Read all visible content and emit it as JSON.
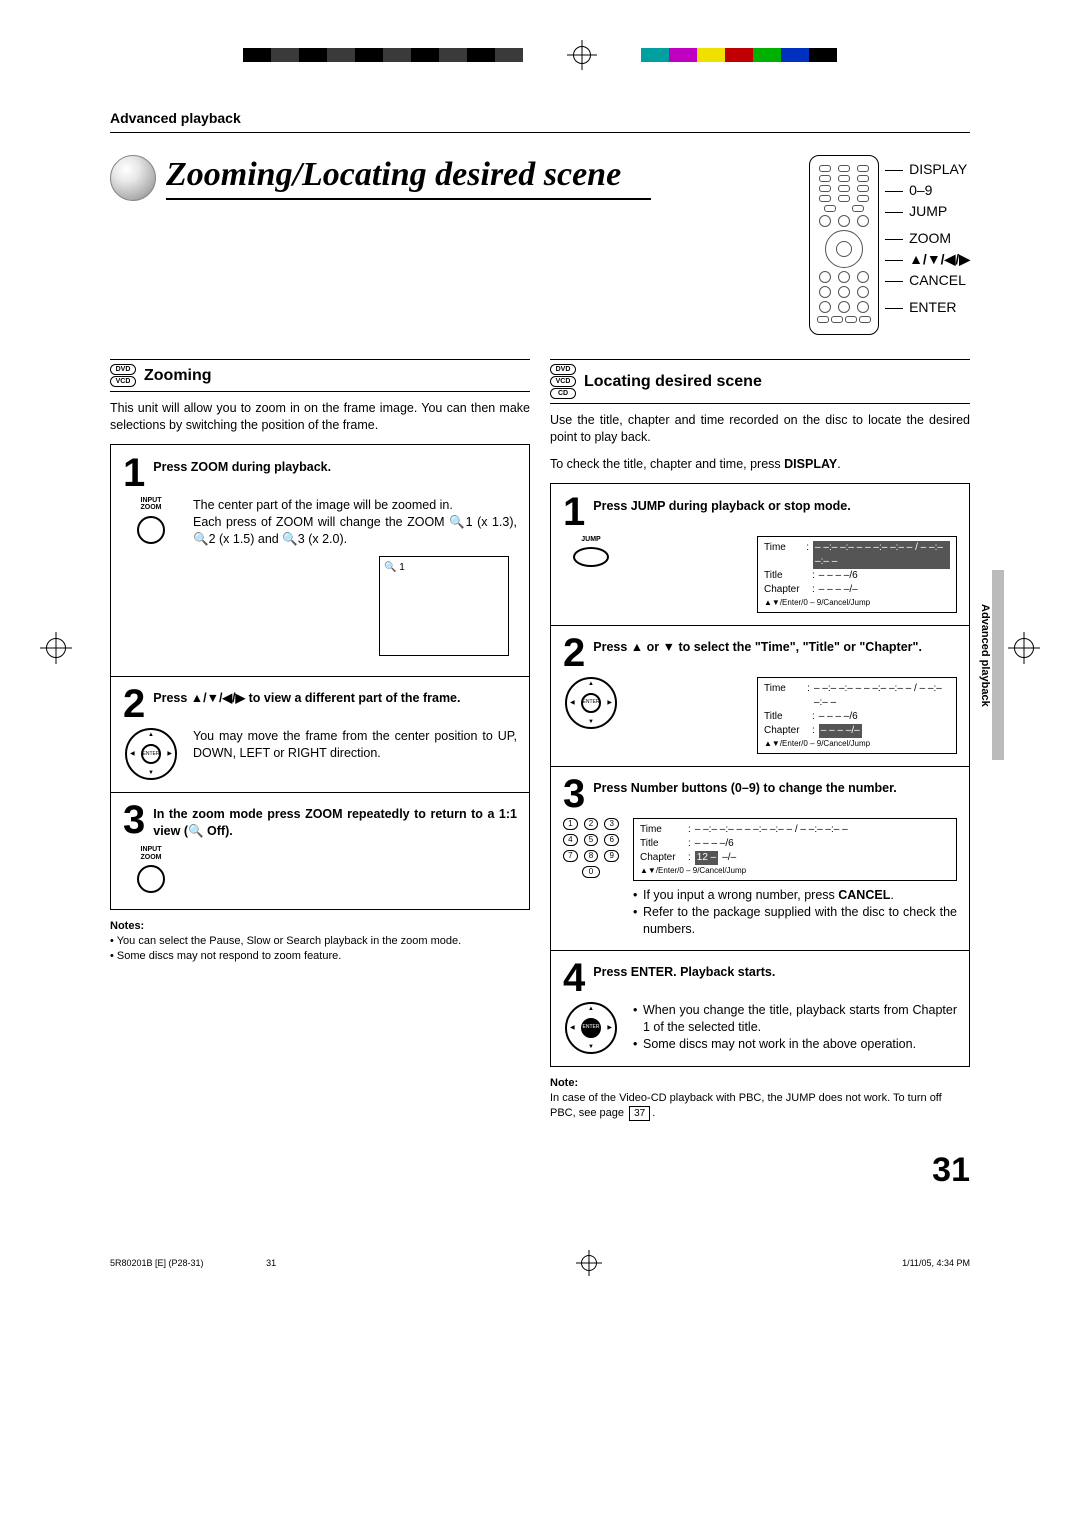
{
  "header": {
    "section": "Advanced playback"
  },
  "hero": {
    "title": "Zooming/Locating desired scene"
  },
  "remote_labels": {
    "display": "DISPLAY",
    "digits": "0–9",
    "jump": "JUMP",
    "zoom": "ZOOM",
    "arrows": "▲/▼/◀/▶",
    "cancel": "CANCEL",
    "enter": "ENTER"
  },
  "zooming": {
    "title": "Zooming",
    "intro": "This unit will allow you to zoom in on the frame image. You can then make selections by switching the position of the frame.",
    "step1": {
      "title": "Press ZOOM during playback.",
      "icon_label": "INPUT\nZOOM",
      "body1": "The center part of the image will be zoomed in.",
      "body2": "Each press of ZOOM will change the ZOOM 🔍1 (x 1.3), 🔍2 (x 1.5) and 🔍3 (x 2.0).",
      "osd": "🔍 1"
    },
    "step2": {
      "title": "Press ▲/▼/◀/▶ to view a different part of the frame.",
      "body": "You may move the frame from the center position to UP, DOWN, LEFT or RIGHT direction."
    },
    "step3": {
      "title": "In the zoom mode press ZOOM repeatedly to return to a 1:1 view (🔍 Off).",
      "icon_label": "INPUT\nZOOM"
    },
    "notes_h": "Notes:",
    "note1": "You can select the Pause, Slow or Search playback in the zoom mode.",
    "note2": "Some discs may not respond to zoom feature."
  },
  "locating": {
    "title": "Locating desired scene",
    "intro1": "Use the title, chapter and time recorded on the disc to locate the desired point to play back.",
    "intro2_a": "To check the title, chapter and time, press ",
    "intro2_b": "DISPLAY",
    "intro2_c": ".",
    "step1": {
      "title": "Press JUMP during playback or stop mode.",
      "icon_label": "JUMP",
      "osd_time": "– –:– –:– –    – –:– –:– – / – –:– –:– –",
      "osd_title": "– – –       –/6",
      "osd_chapter": "– – –       –/–",
      "osd_hint": "▲▼/Enter/0 – 9/Cancel/Jump"
    },
    "step2": {
      "title": "Press ▲ or ▼ to select the \"Time\", \"Title\" or \"Chapter\".",
      "osd_time": "– –:– –:– –    – –:– –:– – / – –:– –:– –",
      "osd_title": "– – –       –/6",
      "osd_chapter": "– – –       –/–",
      "osd_hint": "▲▼/Enter/0 – 9/Cancel/Jump"
    },
    "step3": {
      "title": "Press Number buttons (0–9) to change the number.",
      "osd_time": "– –:– –:– –    – –:– –:– – / – –:– –:– –",
      "osd_title": "– – –       –/6",
      "osd_chapter_val": "12 –",
      "osd_chapter_rest": "       –/–",
      "osd_hint": "▲▼/Enter/0 – 9/Cancel/Jump",
      "bullet1a": "If you input a wrong number, press ",
      "bullet1b": "CANCEL",
      "bullet1c": ".",
      "bullet2": "Refer to the package supplied with the disc to check the numbers."
    },
    "step4": {
      "title": "Press ENTER. Playback starts.",
      "bullet1": "When you change the title, playback starts from Chapter 1 of the selected title.",
      "bullet2": "Some discs may not work in the above operation."
    },
    "note_h": "Note:",
    "note_a": "In case of the Video-CD playback with PBC, the JUMP does not work. To turn off PBC, see page ",
    "note_b": "37",
    "note_c": "."
  },
  "osd_keys": {
    "time": "Time",
    "title": "Title",
    "chapter": "Chapter"
  },
  "side_tab": "Advanced playback",
  "page_number": "31",
  "footer": {
    "left": "5R80201B [E] (P28-31)",
    "mid": "31",
    "right": "1/11/05, 4:34 PM"
  },
  "reg_colors": [
    "#00a0a0",
    "#c000c0",
    "#f0e000",
    "#c00000",
    "#00b000",
    "#0030c0",
    "#000000"
  ]
}
